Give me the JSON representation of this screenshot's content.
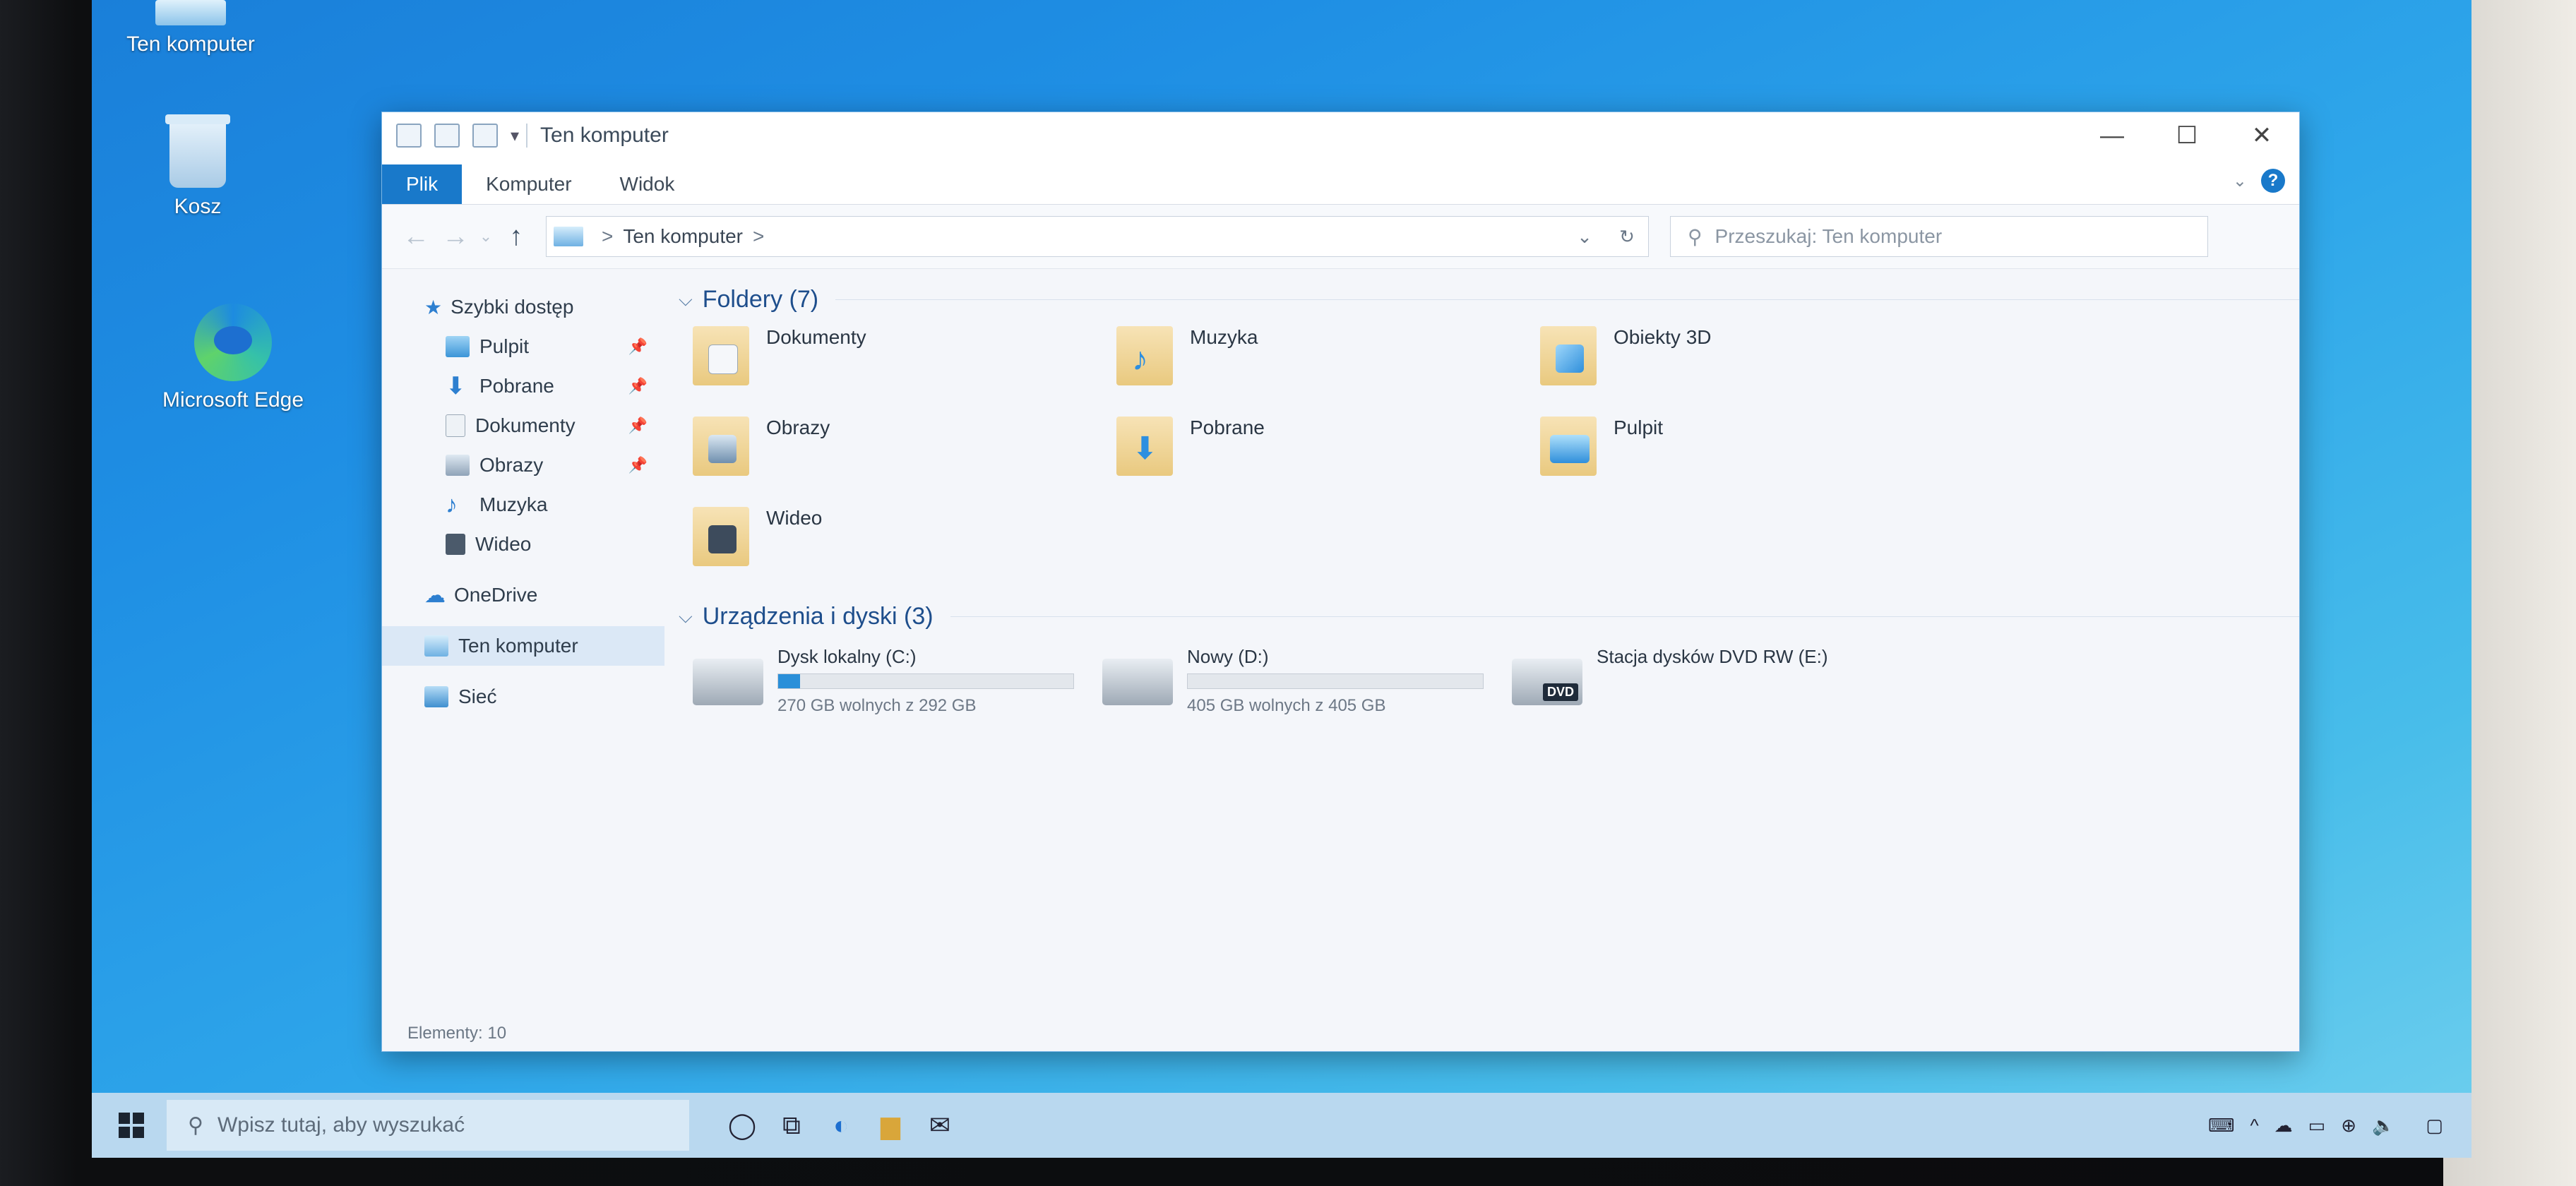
{
  "desktop": {
    "icons": [
      {
        "label": "Ten komputer"
      },
      {
        "label": "Kosz"
      },
      {
        "label": "Microsoft Edge"
      }
    ]
  },
  "explorer": {
    "title": "Ten komputer",
    "ribbon_tabs": [
      "Plik",
      "Komputer",
      "Widok"
    ],
    "help_glyph": "?",
    "address": {
      "location": "Ten komputer",
      "separator": ">"
    },
    "search_placeholder": "Przeszukaj: Ten komputer",
    "sidebar": {
      "quick_access": "Szybki dostęp",
      "quick_items": [
        "Pulpit",
        "Pobrane",
        "Dokumenty",
        "Obrazy",
        "Muzyka",
        "Wideo"
      ],
      "onedrive": "OneDrive",
      "this_pc": "Ten komputer",
      "network": "Sieć"
    },
    "folders_section": "Foldery (7)",
    "folders": [
      {
        "label": "Dokumenty",
        "icon": "document-icon"
      },
      {
        "label": "Muzyka",
        "icon": "music-icon"
      },
      {
        "label": "Obiekty 3D",
        "icon": "cube-icon"
      },
      {
        "label": "Obrazy",
        "icon": "picture-icon"
      },
      {
        "label": "Pobrane",
        "icon": "download-icon"
      },
      {
        "label": "Pulpit",
        "icon": "desktop-icon"
      },
      {
        "label": "Wideo",
        "icon": "video-icon"
      }
    ],
    "devices_section": "Urządzenia i dyski (3)",
    "drives": [
      {
        "label": "Dysk lokalny (C:)",
        "free": "270 GB wolnych z 292 GB",
        "used_fraction": 0.075
      },
      {
        "label": "Nowy (D:)",
        "free": "405 GB wolnych z 405 GB",
        "used_fraction": 0.0
      },
      {
        "label": "Stacja dysków DVD RW (E:)",
        "badge": "DVD"
      }
    ],
    "status": "Elementy: 10"
  },
  "taskbar": {
    "search_placeholder": "Wpisz tutaj, aby wyszukać"
  }
}
